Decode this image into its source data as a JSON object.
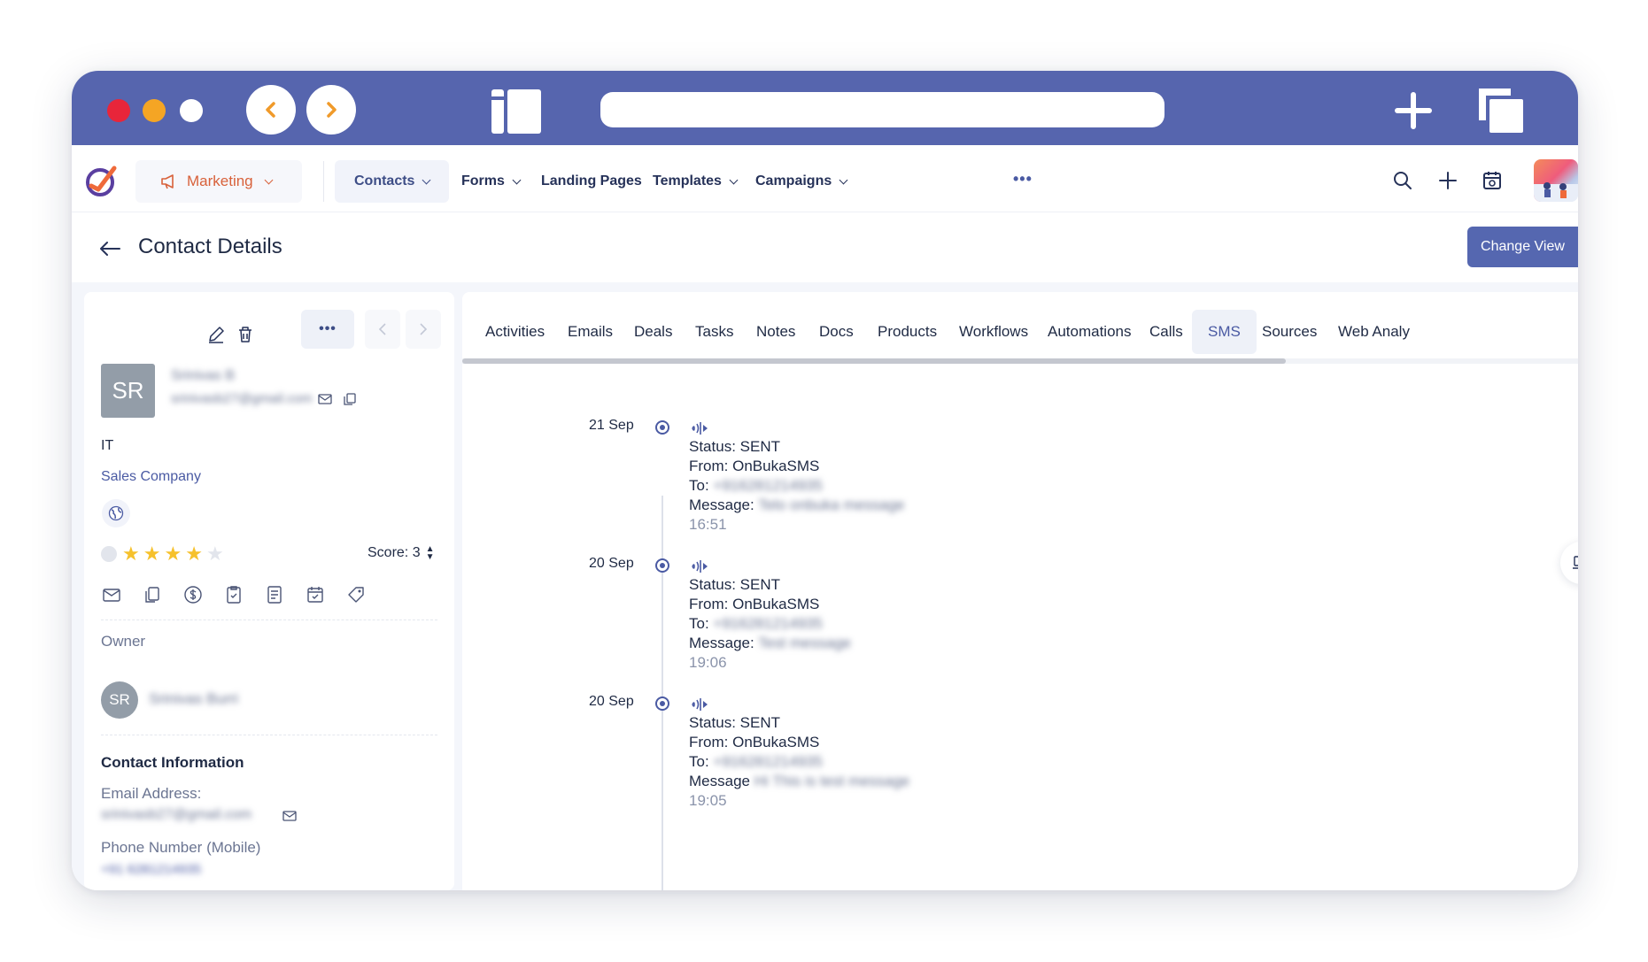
{
  "nav": {
    "module": "Marketing",
    "items": [
      {
        "label": "Contacts"
      },
      {
        "label": "Forms"
      },
      {
        "label": "Landing Pages"
      },
      {
        "label": "Templates"
      },
      {
        "label": "Campaigns"
      }
    ],
    "more": "•••"
  },
  "page": {
    "title": "Contact Details",
    "change_view": "Change View"
  },
  "contact": {
    "initials": "SR",
    "name": "Srinivas B",
    "email": "srinivasb27@gmail.com",
    "department": "IT",
    "company": "Sales Company",
    "rating": 4,
    "score_label": "Score: 3",
    "owner_label": "Owner",
    "owner_initials": "SR",
    "owner_name": "Srinivas Burri",
    "section_title": "Contact Information",
    "email_label": "Email Address:",
    "email_value": "srinivasb27@gmail.com",
    "phone_label": "Phone Number (Mobile)",
    "phone_value": "+91 6281214935"
  },
  "more_label": "•••",
  "tabs": [
    "Activities",
    "Emails",
    "Deals",
    "Tasks",
    "Notes",
    "Docs",
    "Products",
    "Workflows",
    "Automations",
    "Calls",
    "SMS",
    "Sources",
    "Web Analy"
  ],
  "active_tab": "SMS",
  "timeline": [
    {
      "date": "21 Sep",
      "status": "Status: SENT",
      "from": "From: OnBukaSMS",
      "to_label": "To:",
      "to_value": "+916281214935",
      "msg_label": "Message:",
      "msg_value": "Telo onbuka message",
      "time": "16:51"
    },
    {
      "date": "20 Sep",
      "status": "Status: SENT",
      "from": "From: OnBukaSMS",
      "to_label": "To:",
      "to_value": "+916281214935",
      "msg_label": "Message:",
      "msg_value": "Test message",
      "time": "19:06"
    },
    {
      "date": "20 Sep",
      "status": "Status: SENT",
      "from": "From: OnBukaSMS",
      "to_label": "To:",
      "to_value": "+916281214935",
      "msg_label": "Message",
      "msg_value": "Hi This is test message",
      "time": "19:05"
    }
  ],
  "colors": {
    "titlebar": "#5665ae",
    "accent": "#5567b0",
    "module": "#d8613a",
    "star": "#f6c12c",
    "red_light": "#e8253a",
    "yellow_light": "#f5a524"
  }
}
